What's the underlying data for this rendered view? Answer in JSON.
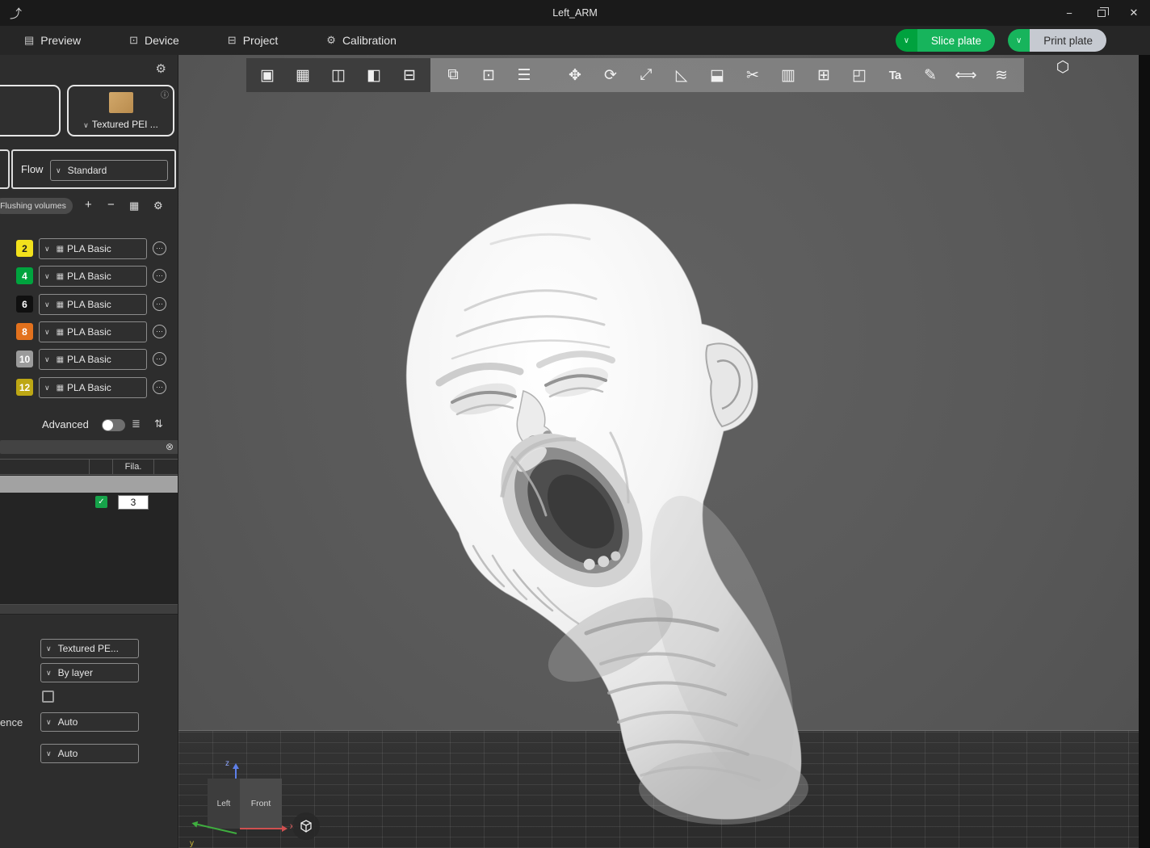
{
  "window": {
    "title": "Left_ARM"
  },
  "icons": {
    "share": "⤴",
    "minimize": "−",
    "close": "✕",
    "preview": "▤",
    "device": "⊡",
    "project": "⊟",
    "calibration": "⚙",
    "chevron_down": "∨",
    "gear": "⚙",
    "info": "ⓘ",
    "plus": "+",
    "minus": "−",
    "flush_matrix": "▦",
    "ellipsis": "⋯",
    "filament": "▦",
    "list": "≣",
    "tune": "⇅",
    "clear": "⊗",
    "check": "✓"
  },
  "nav": {
    "tabs": [
      {
        "label": "Preview"
      },
      {
        "label": "Device"
      },
      {
        "label": "Project"
      },
      {
        "label": "Calibration"
      }
    ],
    "slice_plate": "Slice plate",
    "print_plate": "Print plate"
  },
  "sidebar": {
    "plate_selector": {
      "label": "Textured PEI ..."
    },
    "flow": {
      "label": "Flow",
      "value": "Standard"
    },
    "flushing_label": "Flushing volumes",
    "filaments": [
      {
        "number": "2",
        "value": "PLA Basic",
        "color": "#f2e11c"
      },
      {
        "number": "4",
        "value": "PLA Basic",
        "color": "#00a33e"
      },
      {
        "number": "6",
        "value": "PLA Basic",
        "color": "#101010"
      },
      {
        "number": "8",
        "value": "PLA Basic",
        "color": "#e2711d"
      },
      {
        "number": "10",
        "value": "PLA Basic",
        "color": "#9b9b9b"
      },
      {
        "number": "12",
        "value": "PLA Basic",
        "color": "#bda714"
      }
    ],
    "advanced_label": "Advanced",
    "object_table": {
      "fila_header": "Fila.",
      "filament_value": "3"
    },
    "controls": {
      "plate_type": "Textured PE...",
      "layer_mode": "By layer",
      "sequence_label": "ence",
      "auto_1": "Auto",
      "auto_2": "Auto"
    }
  },
  "viewport": {
    "toolbar": {
      "add_plate": "▣",
      "arrange": "▦",
      "auto_orient": "◫",
      "split_plate": "◧",
      "layout": "⊟",
      "copy": "⧉",
      "paste": "⊡",
      "align": "☰",
      "move": "✥",
      "rotate": "⟳",
      "scale": "⤢",
      "place_on_face": "◺",
      "mirror": "⬓",
      "cut": "✂",
      "variable_layer": "▥",
      "modifier": "⊞",
      "split_object": "◰",
      "text": "Ta",
      "support": "✎",
      "measure": "⟺",
      "seam": "≋",
      "assembly": "⬡"
    },
    "gizmo": {
      "left": "Left",
      "front": "Front",
      "x": "x",
      "y": "y",
      "z": "z"
    }
  }
}
